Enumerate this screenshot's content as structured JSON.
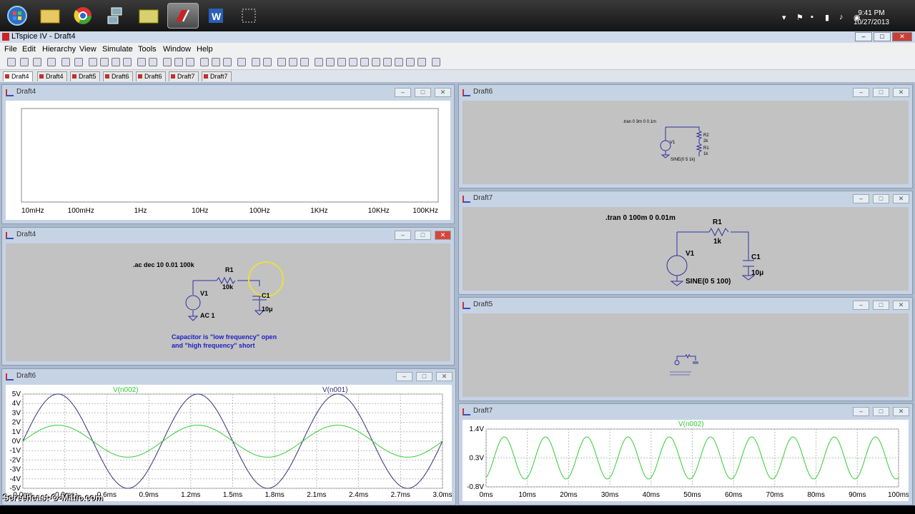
{
  "taskbar": {
    "items": [
      "start-orb",
      "folder-icon",
      "chrome-icon",
      "network-icon",
      "folder2-icon",
      "ltspice-icon",
      "word-icon",
      "snip-icon"
    ],
    "time": "9:41 PM",
    "date": "10/27/2013"
  },
  "app": {
    "title": "LTspice IV - Draft4"
  },
  "menu": [
    "File",
    "Edit",
    "Hierarchy",
    "View",
    "Simulate",
    "Tools",
    "Window",
    "Help"
  ],
  "tabs": [
    "Draft4",
    "Draft4",
    "Draft5",
    "Draft6",
    "Draft6",
    "Draft7",
    "Draft7"
  ],
  "windows": {
    "ac_plot": {
      "title": "Draft4",
      "xticks": [
        "10mHz",
        "100mHz",
        "1Hz",
        "10Hz",
        "100Hz",
        "1KHz",
        "10KHz",
        "100KHz"
      ]
    },
    "rc_schematic": {
      "title": "Draft4",
      "directive": ".ac dec 10 0.01 100k",
      "r1": "R1",
      "r1v": "10k",
      "v1": "V1",
      "v1v": "AC 1",
      "c1": "C1",
      "c1v": "10μ",
      "note1": "Capacitor is \"low frequency\" open",
      "note2": "and \"high frequency\" short"
    },
    "tran_plot": {
      "title": "Draft6",
      "s1": "V(n002)",
      "s2": "V(n001)",
      "yticks": [
        "5V",
        "4V",
        "3V",
        "2V",
        "1V",
        "0V",
        "-1V",
        "-2V",
        "-3V",
        "-4V",
        "-5V"
      ],
      "xticks": [
        "0.0ms",
        "0.3ms",
        "0.6ms",
        "0.9ms",
        "1.2ms",
        "1.5ms",
        "1.8ms",
        "2.1ms",
        "2.4ms",
        "2.7ms",
        "3.0ms"
      ]
    },
    "divider_schematic": {
      "title": "Draft6",
      "directive": ".tran 0 3m 0 0.1m",
      "r2": "R2",
      "r2v": "2k",
      "r1": "R1",
      "r1v": "1k",
      "v1": "V1",
      "v1v": "SINE(0 5 1k)"
    },
    "rc_tran_schematic": {
      "title": "Draft7",
      "directive": ".tran 0 100m 0 0.01m",
      "r1": "R1",
      "r1v": "1k",
      "v1": "V1",
      "v1v": "SINE(0 5 100)",
      "c1": "C1",
      "c1v": "10μ"
    },
    "draft5": {
      "title": "Draft5"
    },
    "rc_tran_plot": {
      "title": "Draft7",
      "s1": "V(n002)",
      "yticks": [
        "1.4V",
        "0.3V",
        "-0.8V"
      ],
      "xticks": [
        "0ms",
        "10ms",
        "20ms",
        "30ms",
        "40ms",
        "50ms",
        "60ms",
        "70ms",
        "80ms",
        "90ms",
        "100ms"
      ]
    }
  },
  "watermark": "Screencast-O-Matic.com",
  "chart_data": [
    {
      "type": "line",
      "title": "",
      "x_unit": "ms",
      "xlim": [
        0,
        3
      ],
      "ylim": [
        -5,
        5
      ],
      "series": [
        {
          "name": "V(n001)",
          "color": "#30307a",
          "amplitude": 5,
          "frequency_hz": 1000
        },
        {
          "name": "V(n002)",
          "color": "#33cc33",
          "amplitude": 1.7,
          "frequency_hz": 1000
        }
      ]
    },
    {
      "type": "line",
      "title": "",
      "x_unit": "ms",
      "xlim": [
        0,
        100
      ],
      "ylim": [
        -0.8,
        1.4
      ],
      "series": [
        {
          "name": "V(n002)",
          "color": "#33cc33",
          "offset": 0.3,
          "amplitude": 0.8,
          "frequency_hz": 100
        }
      ]
    }
  ]
}
